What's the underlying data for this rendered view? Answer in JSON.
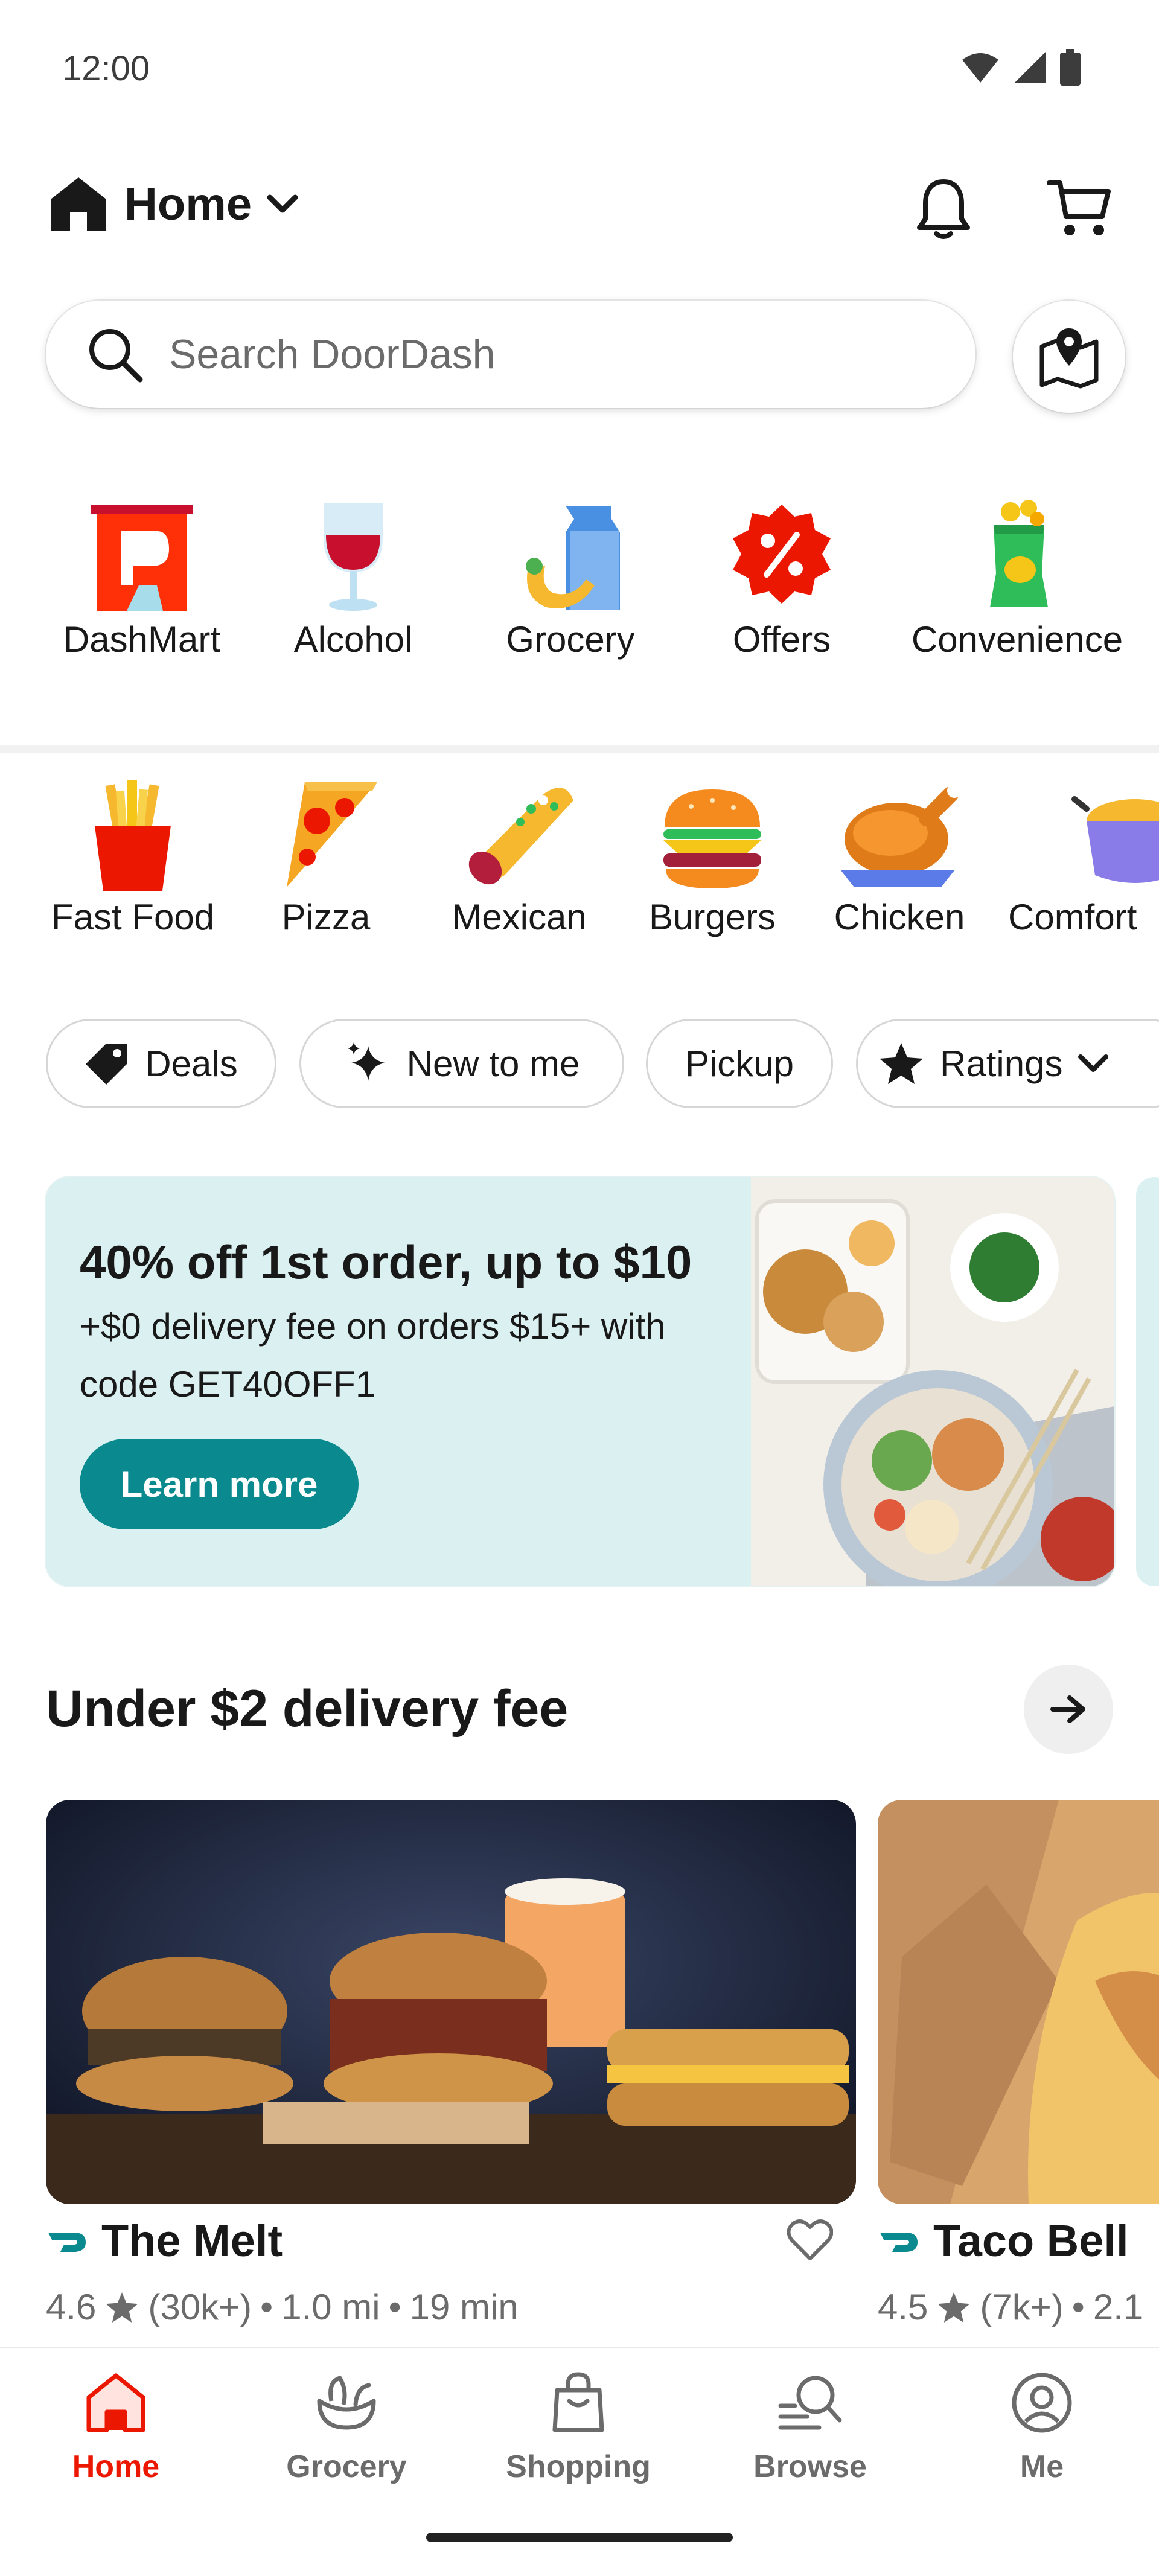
{
  "status_bar": {
    "time": "12:00"
  },
  "header": {
    "address_label": "Home"
  },
  "search": {
    "placeholder": "Search DoorDash"
  },
  "top_categories": [
    {
      "label": "DashMart",
      "icon": "dashmart-icon"
    },
    {
      "label": "Alcohol",
      "icon": "wine-glass-icon"
    },
    {
      "label": "Grocery",
      "icon": "grocery-bag-icon"
    },
    {
      "label": "Offers",
      "icon": "percent-badge-icon"
    },
    {
      "label": "Convenience",
      "icon": "chips-bag-icon"
    }
  ],
  "cuisines": [
    {
      "label": "Fast Food",
      "icon": "fries-icon"
    },
    {
      "label": "Pizza",
      "icon": "pizza-slice-icon"
    },
    {
      "label": "Mexican",
      "icon": "burrito-icon"
    },
    {
      "label": "Burgers",
      "icon": "burger-icon"
    },
    {
      "label": "Chicken",
      "icon": "roast-chicken-icon"
    },
    {
      "label": "Comfort",
      "icon": "mac-and-cheese-icon"
    }
  ],
  "filters": [
    {
      "label": "Deals",
      "icon": "tag-icon"
    },
    {
      "label": "New to me",
      "icon": "sparkle-icon"
    },
    {
      "label": "Pickup"
    },
    {
      "label": "Ratings",
      "icon": "star-icon"
    }
  ],
  "promo": {
    "title": "40% off 1st order, up to $10",
    "subtitle": "+$0 delivery fee on orders $15+ with code GET40OFF1",
    "button_label": "Learn more"
  },
  "section": {
    "title": "Under $2 delivery fee"
  },
  "stores": [
    {
      "name": "The Melt",
      "rating": "4.6",
      "reviews": "(30k+)",
      "distance": "1.0 mi",
      "time": "19 min"
    },
    {
      "name": "Taco Bell",
      "rating": "4.5",
      "reviews": "(7k+)",
      "distance": "2.1",
      "time": ""
    }
  ],
  "bottom_nav": [
    {
      "label": "Home",
      "active": true
    },
    {
      "label": "Grocery"
    },
    {
      "label": "Shopping"
    },
    {
      "label": "Browse"
    },
    {
      "label": "Me"
    }
  ],
  "colors": {
    "brand_red": "#eb1700",
    "teal": "#0a8a8e",
    "promo_bg": "#dbf1f1"
  }
}
